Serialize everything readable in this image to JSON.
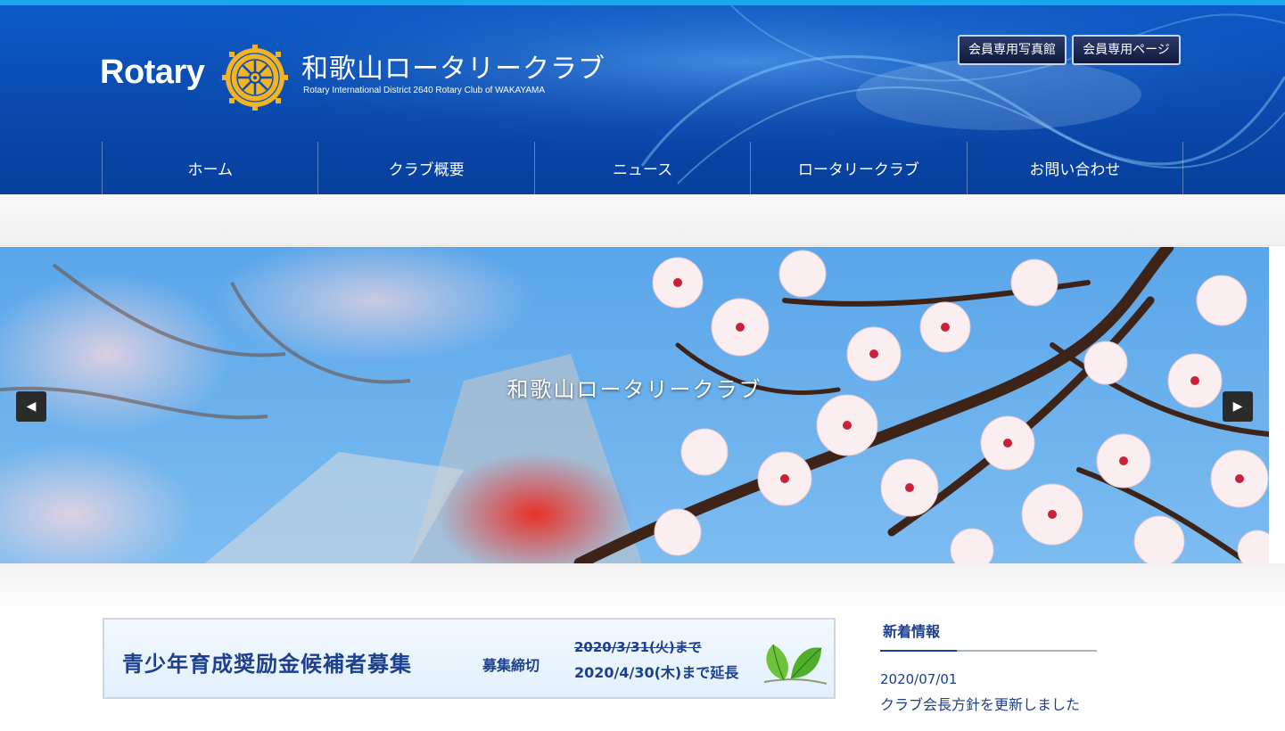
{
  "header": {
    "logo_text": "Rotary",
    "club_name": "和歌山ロータリークラブ",
    "club_subtitle": "Rotary International District 2640 Rotary Club of WAKAYAMA",
    "member_photo_label": "会員専用写真館",
    "member_page_label": "会員専用ページ",
    "colors": {
      "header_blue": "#0a4cb2",
      "accent_strip": "#17a8ee",
      "rotary_gold": "#f2b425"
    }
  },
  "nav": {
    "items": [
      {
        "label": "ホーム"
      },
      {
        "label": "クラブ概要"
      },
      {
        "label": "ニュース"
      },
      {
        "label": "ロータリークラブ"
      },
      {
        "label": "お問い合わせ"
      }
    ]
  },
  "slider": {
    "caption": "和歌山ロータリークラブ",
    "prev_icon": "arrow-left-icon",
    "next_icon": "arrow-right-icon"
  },
  "banner": {
    "title": "青少年育成奨励金候補者募集",
    "deadline_label": "募集締切",
    "old_deadline": "2020/3/31(火)まで",
    "new_deadline": "2020/4/30(木)まで延長",
    "icon": "leaf-icon"
  },
  "news": {
    "heading": "新着情報",
    "items": [
      {
        "date": "2020/07/01",
        "title": "クラブ会長方針を更新しました"
      }
    ]
  }
}
